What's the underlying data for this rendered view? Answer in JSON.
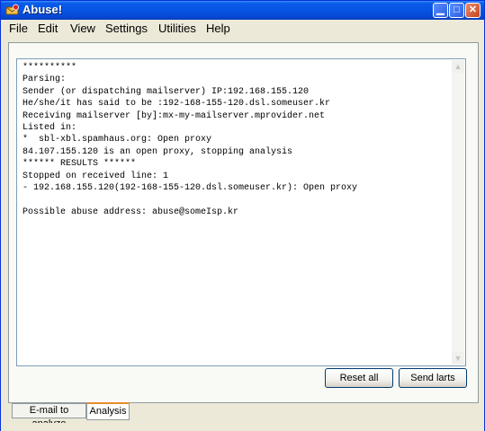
{
  "window": {
    "title": "Abuse!"
  },
  "menu": [
    "File",
    "Edit",
    "View",
    "Settings",
    "Utilities",
    "Help"
  ],
  "output_lines": [
    "**********",
    "Parsing:",
    "Sender (or dispatching mailserver) IP:192.168.155.120",
    "He/she/it has said to be :192-168-155-120.dsl.someuser.kr",
    "Receiving mailserver [by]:mx-my-mailserver.mprovider.net",
    "Listed in:",
    "*  sbl-xbl.spamhaus.org: Open proxy",
    "84.107.155.120 is an open proxy, stopping analysis",
    "****** RESULTS ******",
    "Stopped on received line: 1",
    "- 192.168.155.120(192-168-155-120.dsl.someuser.kr): Open proxy",
    "",
    "Possible abuse address: abuse@someIsp.kr"
  ],
  "buttons": {
    "reset": "Reset all",
    "send": "Send larts"
  },
  "tabs": [
    "E-mail to analyze",
    "Analysis"
  ],
  "active_tab": "Analysis"
}
